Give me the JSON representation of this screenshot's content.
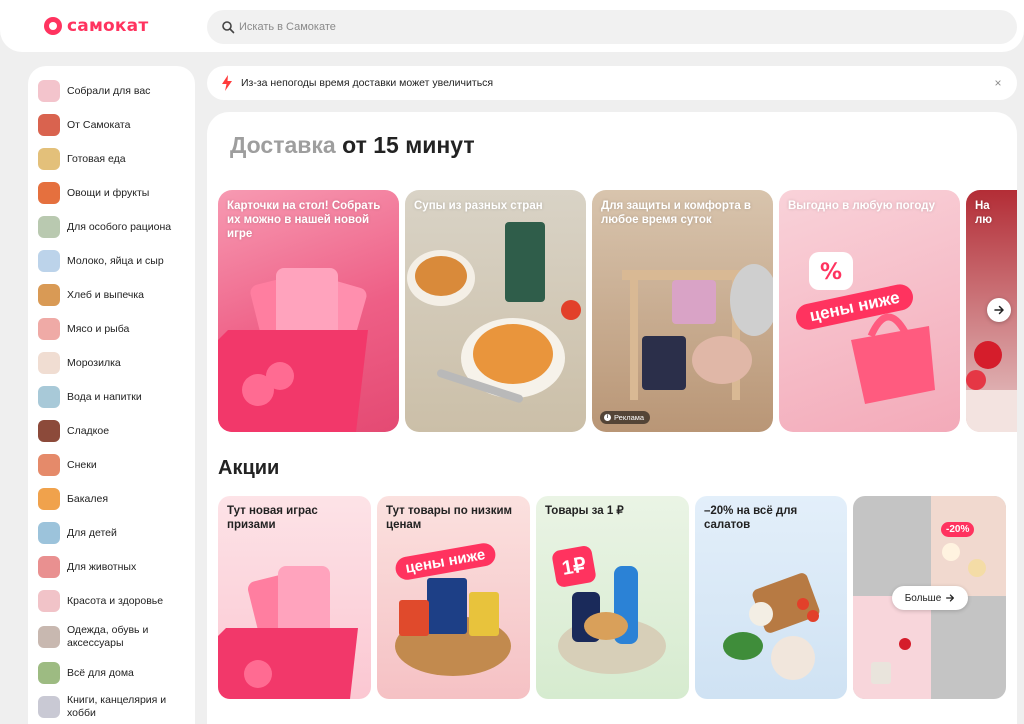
{
  "brand": {
    "name": "самокат",
    "color": "#ff335f"
  },
  "search": {
    "placeholder": "Искать в Самокате",
    "icon": "search-icon"
  },
  "notice": {
    "text": "Из-за непогоды время доставки может увеличиться",
    "icon": "lightning-icon",
    "close": "×"
  },
  "sidebar": {
    "items": [
      {
        "label": "Собрали для вас",
        "color": "#f3c4cc"
      },
      {
        "label": "От Самоката",
        "color": "#d9634f"
      },
      {
        "label": "Готовая еда",
        "color": "#e3c07a"
      },
      {
        "label": "Овощи и фрукты",
        "color": "#e5703e"
      },
      {
        "label": "Для особого рациона",
        "color": "#b9c9b0"
      },
      {
        "label": "Молоко, яйца и сыр",
        "color": "#bcd3ea"
      },
      {
        "label": "Хлеб и выпечка",
        "color": "#d99a55"
      },
      {
        "label": "Мясо и рыба",
        "color": "#efaaa6"
      },
      {
        "label": "Морозилка",
        "color": "#f0ddd2"
      },
      {
        "label": "Вода и напитки",
        "color": "#a8c9d8"
      },
      {
        "label": "Сладкое",
        "color": "#8c4a3a"
      },
      {
        "label": "Снеки",
        "color": "#e58a6a"
      },
      {
        "label": "Бакалея",
        "color": "#f0a24c"
      },
      {
        "label": "Для детей",
        "color": "#9cc3db"
      },
      {
        "label": "Для животных",
        "color": "#e99090"
      },
      {
        "label": "Красота и здоровье",
        "color": "#f1c3c8"
      },
      {
        "label": "Одежда, обувь и аксессуары",
        "color": "#c8b8b0"
      },
      {
        "label": "Всё для дома",
        "color": "#9dbb82"
      },
      {
        "label": "Книги, канцелярия и хобби",
        "color": "#c9c9d4"
      }
    ]
  },
  "main": {
    "headline_grey": "Доставка",
    "headline_dark": "от 15 минут",
    "stories": [
      {
        "title": "Карточки на стол! Собрать их можно в нашей новой игре",
        "bg": "#ef5f86"
      },
      {
        "title": "Супы из разных стран",
        "bg": "#d9cdb6"
      },
      {
        "title": "Для защиты и комфорта в любое время суток",
        "bg": "#c9a98c",
        "ad": "Реклама"
      },
      {
        "title": "Выгодно в любую погоду",
        "bg": "#f6bfc8",
        "overlay": "цены ниже"
      },
      {
        "title": "На лю",
        "bg": "#d63a42"
      }
    ],
    "promos_title": "Акции",
    "promos": [
      {
        "title": "Тут новая играс призами",
        "bg": "#fbd2d9"
      },
      {
        "title": "Тут товары по низким ценам",
        "bg": "#f8d7d7",
        "overlay": "цены ниже"
      },
      {
        "title": "Товары за 1 ₽",
        "bg": "#dff0d9",
        "overlay": "1₽"
      },
      {
        "title": "–20% на всё для салатов",
        "bg": "#d8e9f7"
      },
      {
        "title": "",
        "bg": "#c4c4c4",
        "badge": "-20%"
      }
    ],
    "more_label": "Больше",
    "next_icon": "arrow-right-icon"
  }
}
